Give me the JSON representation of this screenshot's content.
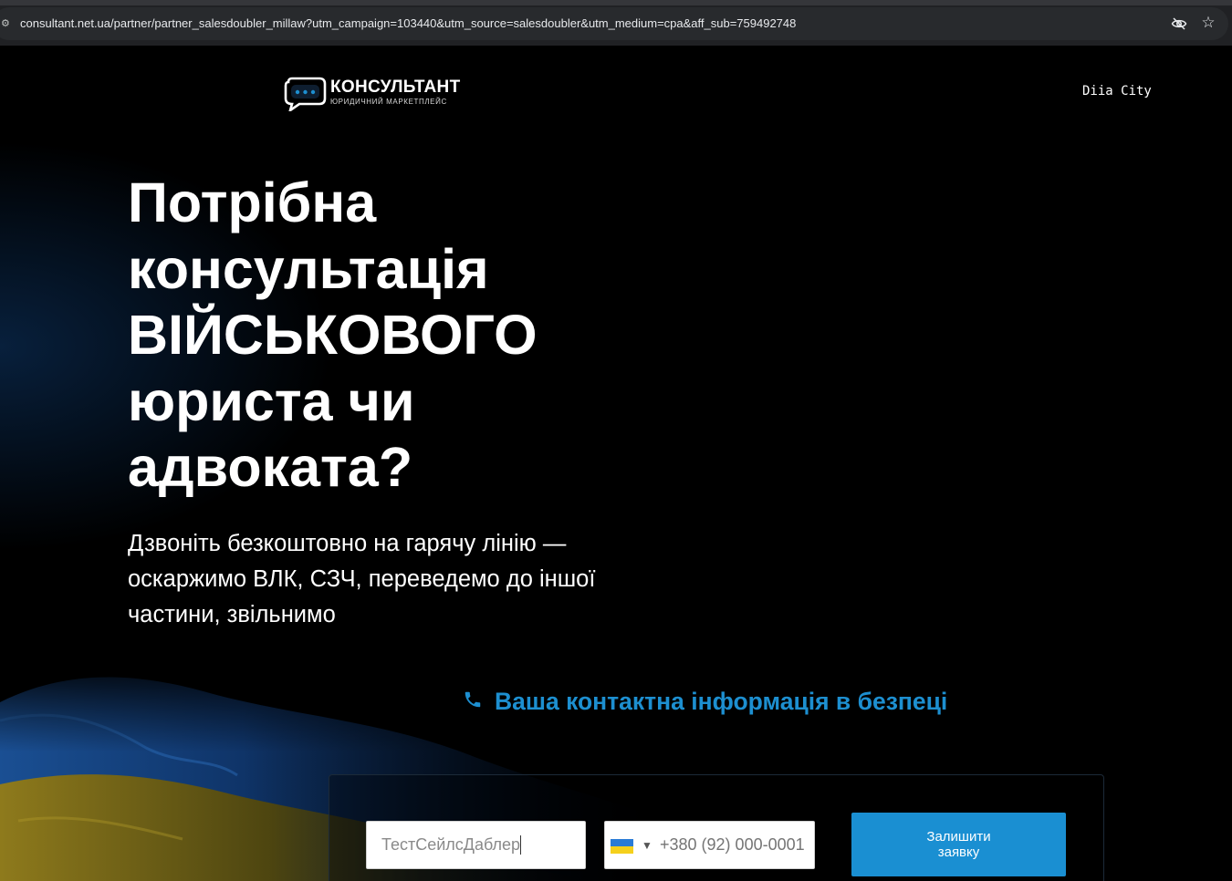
{
  "browser": {
    "url": "consultant.net.ua/partner/partner_salesdoubler_millaw?utm_campaign=103440&utm_source=salesdoubler&utm_medium=cpa&aff_sub=759492748"
  },
  "header": {
    "logo_name": "КОНСУЛЬТАНТ",
    "logo_subtitle": "ЮРИДИЧНИЙ МАРКЕТПЛЕЙС",
    "partner_logo": "Diia City"
  },
  "hero": {
    "title_lines": [
      "Потрібна",
      "консультація",
      "ВІЙСЬКОВОГО",
      "юриста чи",
      "адвоката?"
    ],
    "subtitle_lines": [
      "Дзвоніть безкоштовно на гарячу лінію —",
      "оскаржимо ВЛК, СЗЧ, переведемо до іншої",
      "частини, звільнимо"
    ]
  },
  "safety_note": "Ваша контактна інформація в безпеці",
  "form": {
    "name_value": "ТестСейлсДаблер",
    "phone_placeholder": "+380 (92) 000-0001",
    "country_icon": "ukraine-flag-icon",
    "submit_label_lines": [
      "Залишити",
      "заявку"
    ]
  },
  "colors": {
    "accent": "#1a8fd2",
    "safety_text": "#1d8fd0",
    "background": "#000000"
  }
}
